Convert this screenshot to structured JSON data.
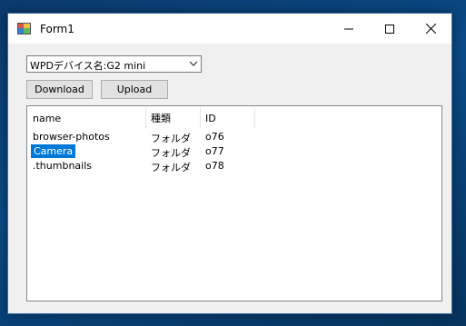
{
  "window": {
    "title": "Form1",
    "minimize_symbol": "—",
    "maximize_symbol": "☐",
    "close_symbol": "✕"
  },
  "device_combo": {
    "selected": "WPDデバイス名:G2 mini",
    "arrow_icon": "chevron-down-icon"
  },
  "buttons": {
    "download_label": "Download",
    "upload_label": "Upload"
  },
  "listview": {
    "columns": [
      "name",
      "種類",
      "ID"
    ],
    "rows": [
      {
        "name": "browser-photos",
        "type": "フォルダ",
        "id": "o76",
        "selected": false
      },
      {
        "name": "Camera",
        "type": "フォルダ",
        "id": "o77",
        "selected": true
      },
      {
        "name": ".thumbnails",
        "type": "フォルダ",
        "id": "o78",
        "selected": false
      }
    ]
  },
  "colors": {
    "selection": "#0078d7",
    "desktop": "#0a4a86"
  }
}
